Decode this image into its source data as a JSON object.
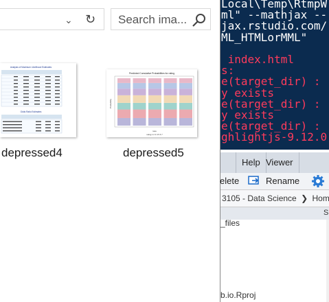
{
  "explorer": {
    "nav": {
      "dropdown_icon": "chevron-down-icon",
      "refresh_icon": "refresh-icon"
    },
    "search": {
      "placeholder": "Search ima...",
      "icon": "search-icon"
    },
    "files": [
      {
        "name": "depressed4",
        "title": "Analysis of Maximum Likelihood Estimates",
        "subtitle": "Odds Ratio Estimates"
      },
      {
        "name": "depressed5",
        "title": "Predicted Cumulative Probabilities for rating",
        "xlabel": "race",
        "ylabel": "Probability",
        "legend": "rating 1 2 3 4 5 6 7"
      }
    ]
  },
  "rstudio": {
    "terminal_lines": [
      {
        "text": "Local\\Temp\\RtmpW",
        "color": "#ffffff"
      },
      {
        "text": "ml\" --mathjax --",
        "color": "#ffffff"
      },
      {
        "text": "jax.rstudio.com/",
        "color": "#ffffff"
      },
      {
        "text": "ML_HTMLorMML\"",
        "color": "#ffffff"
      },
      {
        "text": "",
        "color": "#ffffff"
      },
      {
        "text": " index.html",
        "color": "#ff3b5c"
      },
      {
        "text": "s:",
        "color": "#ff3b5c"
      },
      {
        "text": "e(target_dir) :",
        "color": "#ff3b5c"
      },
      {
        "text": "y exists",
        "color": "#ff3b5c"
      },
      {
        "text": "e(target_dir) :",
        "color": "#ff3b5c"
      },
      {
        "text": "y exists",
        "color": "#ff3b5c"
      },
      {
        "text": "e(target_dir) :",
        "color": "#ff3b5c"
      },
      {
        "text": "ghlightjs-9.12.0",
        "color": "#ff3b5c"
      }
    ],
    "tabs": [
      "Help",
      "Viewer"
    ],
    "toolbar": {
      "delete_label": "elete",
      "rename_label": "Rename",
      "gear_icon": "gear-icon"
    },
    "breadcrumb": {
      "text": "3105 - Data Science",
      "next": "Hom"
    },
    "header_fragment": "S",
    "files": [
      "_files",
      "b.io.Rproj"
    ]
  }
}
